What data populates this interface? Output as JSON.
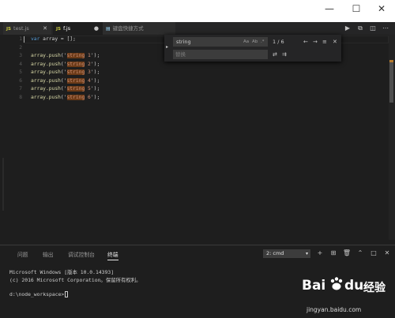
{
  "window": {
    "minimize_glyph": "—",
    "maximize_glyph": "☐",
    "close_glyph": "✕"
  },
  "tabs": [
    {
      "icon": "JS",
      "label": "test.js",
      "close": "✕"
    },
    {
      "icon": "JS",
      "label": "f.js",
      "close": "●"
    },
    {
      "icon": "doc-icon",
      "label": "键盘快捷方式"
    }
  ],
  "tab_actions": [
    "run-icon",
    "split-compare-icon",
    "split-editor-icon",
    "more-icon"
  ],
  "editor": {
    "line_numbers": [
      "1",
      "2",
      "3",
      "4",
      "5",
      "6",
      "7",
      "8"
    ],
    "line1": {
      "kw": "var",
      "rest": " array = [];"
    },
    "push_lines": [
      {
        "fn": "array.push",
        "open": "('",
        "match": "string",
        "num": " 1",
        "close": "');"
      },
      {
        "fn": "array.push",
        "open": "('",
        "match": "string",
        "num": " 2",
        "close": "');"
      },
      {
        "fn": "array.push",
        "open": "('",
        "match": "string",
        "num": " 3",
        "close": "');"
      },
      {
        "fn": "array.push",
        "open": "('",
        "match": "string",
        "num": " 4",
        "close": "');"
      },
      {
        "fn": "array.push",
        "open": "('",
        "match": "string",
        "num": " 5",
        "close": "');"
      },
      {
        "fn": "array.push",
        "open": "('",
        "match": "string",
        "num": " 6",
        "close": "');"
      }
    ]
  },
  "find_widget": {
    "toggle_glyph": "▸",
    "search_value": "string",
    "options": [
      "Aa",
      "Ab",
      ".*"
    ],
    "replace_placeholder": "替换",
    "match_count": "1 / 6",
    "prev_glyph": "←",
    "next_glyph": "→",
    "selection_glyph": "≡",
    "close_glyph": "✕",
    "replace_glyph": "⇄",
    "replace_all_glyph": "⇉"
  },
  "panel": {
    "tabs": [
      "问题",
      "输出",
      "调试控制台",
      "终端"
    ],
    "active_tab": "终端",
    "terminal_select": "2: cmd",
    "select_chevron": "▾",
    "actions": [
      "+",
      "⊞",
      "🗑",
      "⌃",
      "□",
      "✕"
    ],
    "terminal_lines": [
      "Microsoft Windows [版本 10.0.14393]",
      "(c) 2016 Microsoft Corporation。保留所有权利。",
      "",
      "d:\\node_workspace>"
    ]
  },
  "watermark": {
    "brand": "Bai",
    "brand2": "du",
    "cn": "经验",
    "url": "jingyan.baidu.com"
  },
  "colors": {
    "editor_bg": "#1e1e1e",
    "match_highlight": "#6b3a17",
    "keyword": "#569cd6",
    "string": "#ce9178",
    "function": "#dcdcaa"
  }
}
